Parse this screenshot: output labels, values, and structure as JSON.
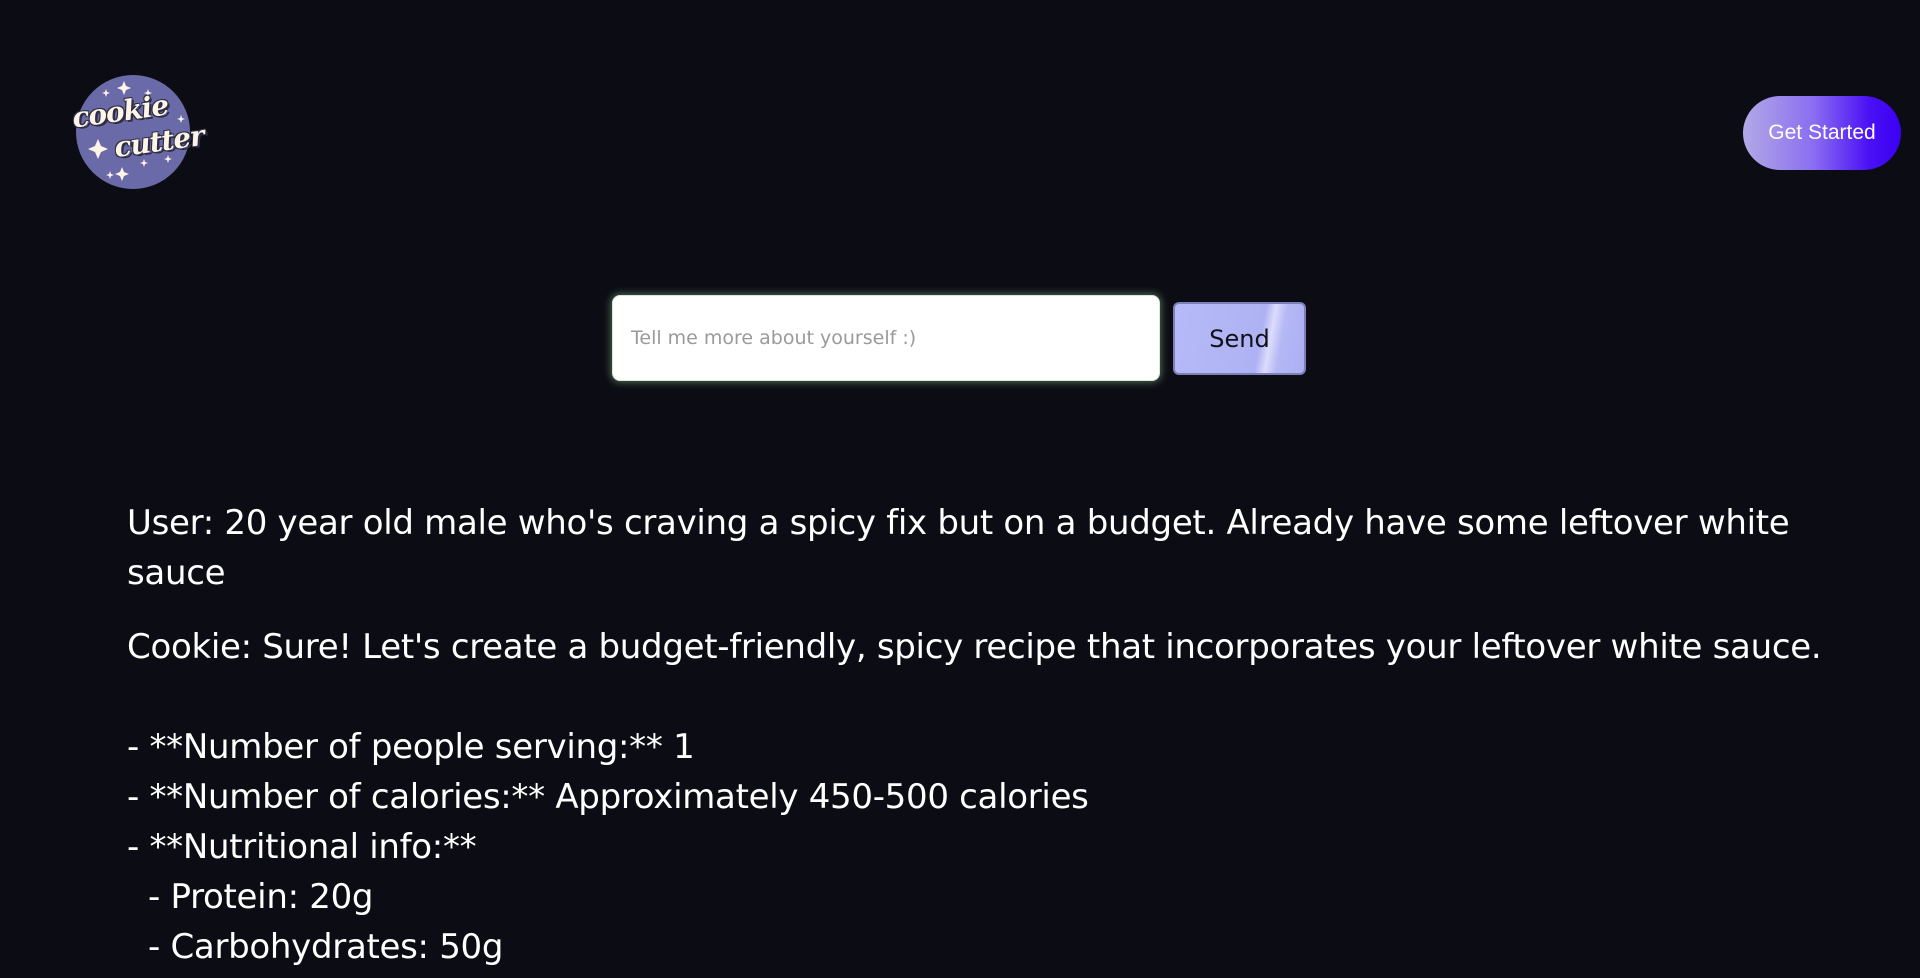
{
  "logo": {
    "line1": "cookie",
    "line2": "cutter"
  },
  "header": {
    "cta_label": "Get Started"
  },
  "chat": {
    "input_placeholder": "Tell me more about yourself :)",
    "send_label": "Send"
  },
  "conversation": {
    "user_message": "User: 20 year old male who's craving a spicy fix but on a budget. Already have some leftover white sauce",
    "assistant_intro": "Cookie: Sure! Let's create a budget-friendly, spicy recipe that incorporates your leftover white sauce.",
    "recipe_lines": [
      "- **Number of people serving:** 1",
      "- **Number of calories:** Approximately 450-500 calories",
      "- **Nutritional info:**",
      "  - Protein: 20g",
      "  - Carbohydrates: 50g"
    ]
  },
  "colors": {
    "background": "#0c0d14",
    "logo_circle": "#6b6aa8",
    "cta_gradient_end": "#3a00f2",
    "send_button": "#b7baf7"
  }
}
